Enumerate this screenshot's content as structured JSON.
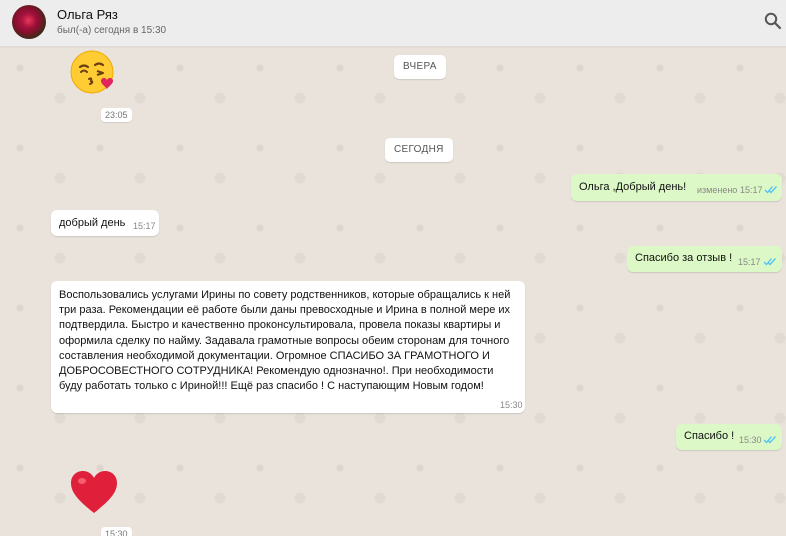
{
  "contact": {
    "name": "Ольга Ряз",
    "status": "был(-а) сегодня в 15:30"
  },
  "icons": {
    "search": "search-icon",
    "avatar": "avatar"
  },
  "colors": {
    "outgoing_bubble": "#dcf8c6",
    "incoming_bubble": "#ffffff",
    "read_ticks": "#4fc3f7"
  },
  "date_chips": {
    "yesterday": "ВЧЕРА",
    "today": "СЕГОДНЯ"
  },
  "messages": [
    {
      "kind": "emoji",
      "emoji": "😘",
      "time": "23:05"
    },
    {
      "kind": "text",
      "direction": "out",
      "text": "Ольга ,Добрый день!",
      "edited": "изменено",
      "time": "15:17"
    },
    {
      "kind": "text",
      "direction": "in",
      "text": "добрый день",
      "time": "15:17"
    },
    {
      "kind": "text",
      "direction": "out",
      "text": "Спасибо за отзыв !",
      "time": "15:17"
    },
    {
      "kind": "text",
      "direction": "in",
      "text": "Воспользовались услугами Ирины по совету родственников, которые обращались к ней три раза. Рекомендации её работе были даны превосходные и Ирина в полной мере их подтвердила. Быстро и качественно проконсультировала, провела показы квартиры и оформила сделку по найму. Задавала грамотные вопросы обеим сторонам для точного составления необходимой документации. Огромное СПАСИБО ЗА ГРАМОТНОГО И ДОБРОСОВЕСТНОГО СОТРУДНИКА! Рекомендую однозначно!. При необходимости буду работать только с Ириной!!! Ещё раз спасибо ! С наступающим Новым годом!",
      "time": "15:30"
    },
    {
      "kind": "text",
      "direction": "out",
      "text": "Спасибо !",
      "time": "15:30"
    },
    {
      "kind": "emoji",
      "emoji": "❤️",
      "time": "15:30"
    }
  ]
}
